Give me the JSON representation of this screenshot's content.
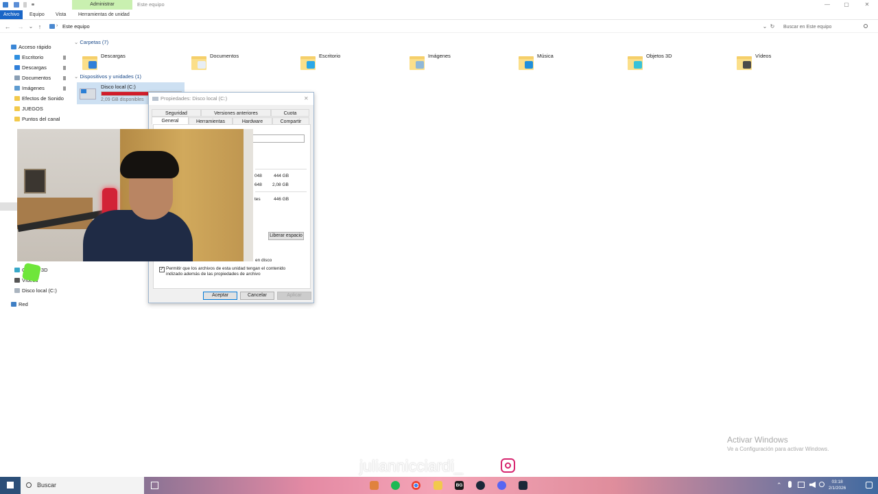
{
  "titlebar": {
    "contextual_tab": "Administrar",
    "window_title": "Este equipo",
    "minimize": "—",
    "maximize": "▢",
    "close": "✕"
  },
  "ribbon": {
    "tabs": [
      "Archivo",
      "Equipo",
      "Vista",
      "Herramientas de unidad"
    ]
  },
  "address": {
    "back": "←",
    "forward": "→",
    "recent": "⌄",
    "up": "↑",
    "path": "Este equipo",
    "dropdown": "⌄",
    "refresh": "↻",
    "search_placeholder": "Buscar en Este equipo"
  },
  "navpane": {
    "items": [
      {
        "label": "Acceso rápido",
        "icon": "star-icon"
      },
      {
        "label": "Escritorio",
        "icon": "desktop-icon",
        "pinned": true
      },
      {
        "label": "Descargas",
        "icon": "download-icon",
        "pinned": true
      },
      {
        "label": "Documentos",
        "icon": "document-icon",
        "pinned": true
      },
      {
        "label": "Imágenes",
        "icon": "image-icon",
        "pinned": true
      },
      {
        "label": "Efectos de Sonido",
        "icon": "folder-icon"
      },
      {
        "label": "JUEGOS",
        "icon": "folder-icon"
      },
      {
        "label": "Puntos del canal",
        "icon": "folder-icon"
      },
      {
        "label": "Objetos 3D",
        "icon": "cube-icon"
      },
      {
        "label": "Vídeos",
        "icon": "video-icon"
      },
      {
        "label": "Disco local (C:)",
        "icon": "drive-icon"
      },
      {
        "label": "Red",
        "icon": "network-icon"
      }
    ],
    "pin_glyph": "📌"
  },
  "content": {
    "folders_header": "Carpetas (7)",
    "folders": [
      {
        "label": "Descargas",
        "glyph_color": "#2f7fd9"
      },
      {
        "label": "Documentos",
        "glyph_color": "#e8eef5"
      },
      {
        "label": "Escritorio",
        "glyph_color": "#2aa7e8"
      },
      {
        "label": "Imágenes",
        "glyph_color": "#8fb8d8"
      },
      {
        "label": "Música",
        "glyph_color": "#1f8fdc"
      },
      {
        "label": "Objetos 3D",
        "glyph_color": "#38c2d8"
      },
      {
        "label": "Vídeos",
        "glyph_color": "#4a4a4a"
      }
    ],
    "devices_header": "Dispositivos y unidades (1)",
    "drive": {
      "label": "Disco local (C:)",
      "free": "2,09 GB disponibles",
      "fill_fraction": 0.995
    }
  },
  "dialog": {
    "title": "Propiedades: Disco local (C:)",
    "close": "✕",
    "tabs_row1": [
      "Seguridad",
      "Versiones anteriores",
      "Cuota"
    ],
    "tabs_row2": [
      "General",
      "Herramientas",
      "Hardware",
      "Compartir"
    ],
    "sizes": [
      {
        "bytes_fragment": "048",
        "size": "444 GB"
      },
      {
        "bytes_fragment": "648",
        "size": "2,08 GB"
      },
      {
        "bytes_fragment": "tes",
        "size": "446 GB"
      }
    ],
    "cleanup_button": "Liberar espacio",
    "compress_fragment": "en disco",
    "index_checkbox": "Permitir que los archivos de esta unidad tengan el contenido indizado además de las propiedades de archivo",
    "index_checked": true,
    "buttons": {
      "ok": "Aceptar",
      "cancel": "Cancelar",
      "apply": "Aplicar"
    }
  },
  "overlay": {
    "watermark": "juliannicciardi_",
    "activate_title": "Activar Windows",
    "activate_sub": "Ve a Configuración para activar Windows."
  },
  "taskbar": {
    "search": "Buscar",
    "clock_time": "03:18",
    "clock_date": "2/1/2026",
    "apps": [
      "chrome-icon",
      "spotify-icon",
      "chrome-icon",
      "explorer-icon",
      "bg-icon",
      "steam-icon",
      "discord-icon",
      "steam-icon"
    ],
    "bg_label": "BG"
  },
  "colors": {
    "accent": "#1a66c7",
    "drive_bar_full": "#d01c2a",
    "drive_tile": "#cde0f2",
    "admin_tab": "#c9f0b0"
  }
}
